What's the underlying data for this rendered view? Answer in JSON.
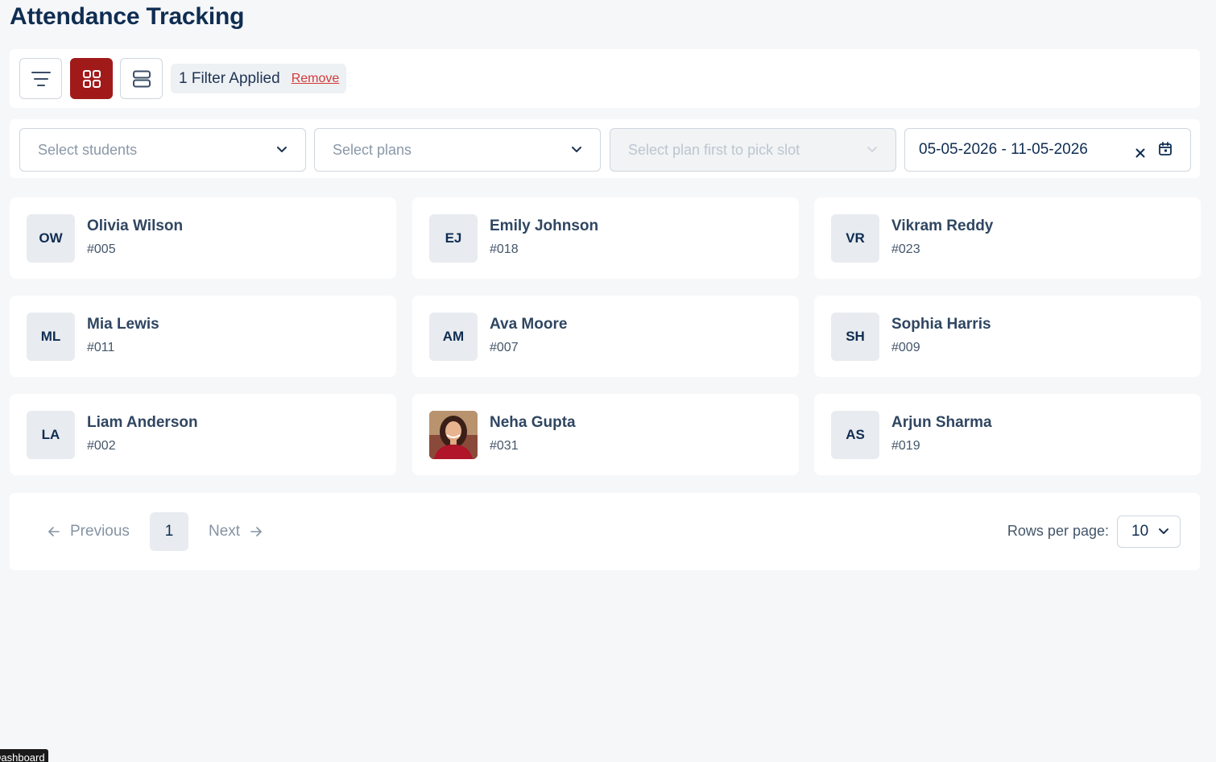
{
  "page": {
    "title": "Attendance Tracking"
  },
  "toolbar": {
    "filter_status": "1 Filter Applied",
    "remove_label": "Remove",
    "accent_color": "#a11a1a"
  },
  "filters": {
    "students_placeholder": "Select students",
    "plans_placeholder": "Select plans",
    "slot_placeholder": "Select plan first to pick slot",
    "date_range": "05-05-2026 - 11-05-2026"
  },
  "students": [
    {
      "initials": "OW",
      "name": "Olivia Wilson",
      "id": "#005"
    },
    {
      "initials": "EJ",
      "name": "Emily Johnson",
      "id": "#018"
    },
    {
      "initials": "VR",
      "name": "Vikram Reddy",
      "id": "#023"
    },
    {
      "initials": "ML",
      "name": "Mia Lewis",
      "id": "#011"
    },
    {
      "initials": "AM",
      "name": "Ava Moore",
      "id": "#007"
    },
    {
      "initials": "SH",
      "name": "Sophia Harris",
      "id": "#009"
    },
    {
      "initials": "LA",
      "name": "Liam Anderson",
      "id": "#002"
    },
    {
      "initials": "",
      "name": "Neha Gupta",
      "id": "#031",
      "has_photo": true
    },
    {
      "initials": "AS",
      "name": "Arjun Sharma",
      "id": "#019"
    }
  ],
  "pagination": {
    "previous_label": "Previous",
    "next_label": "Next",
    "current_page": "1",
    "rows_label": "Rows per page:",
    "rows_value": "10"
  },
  "tooltip": {
    "text": "Dashboard"
  }
}
